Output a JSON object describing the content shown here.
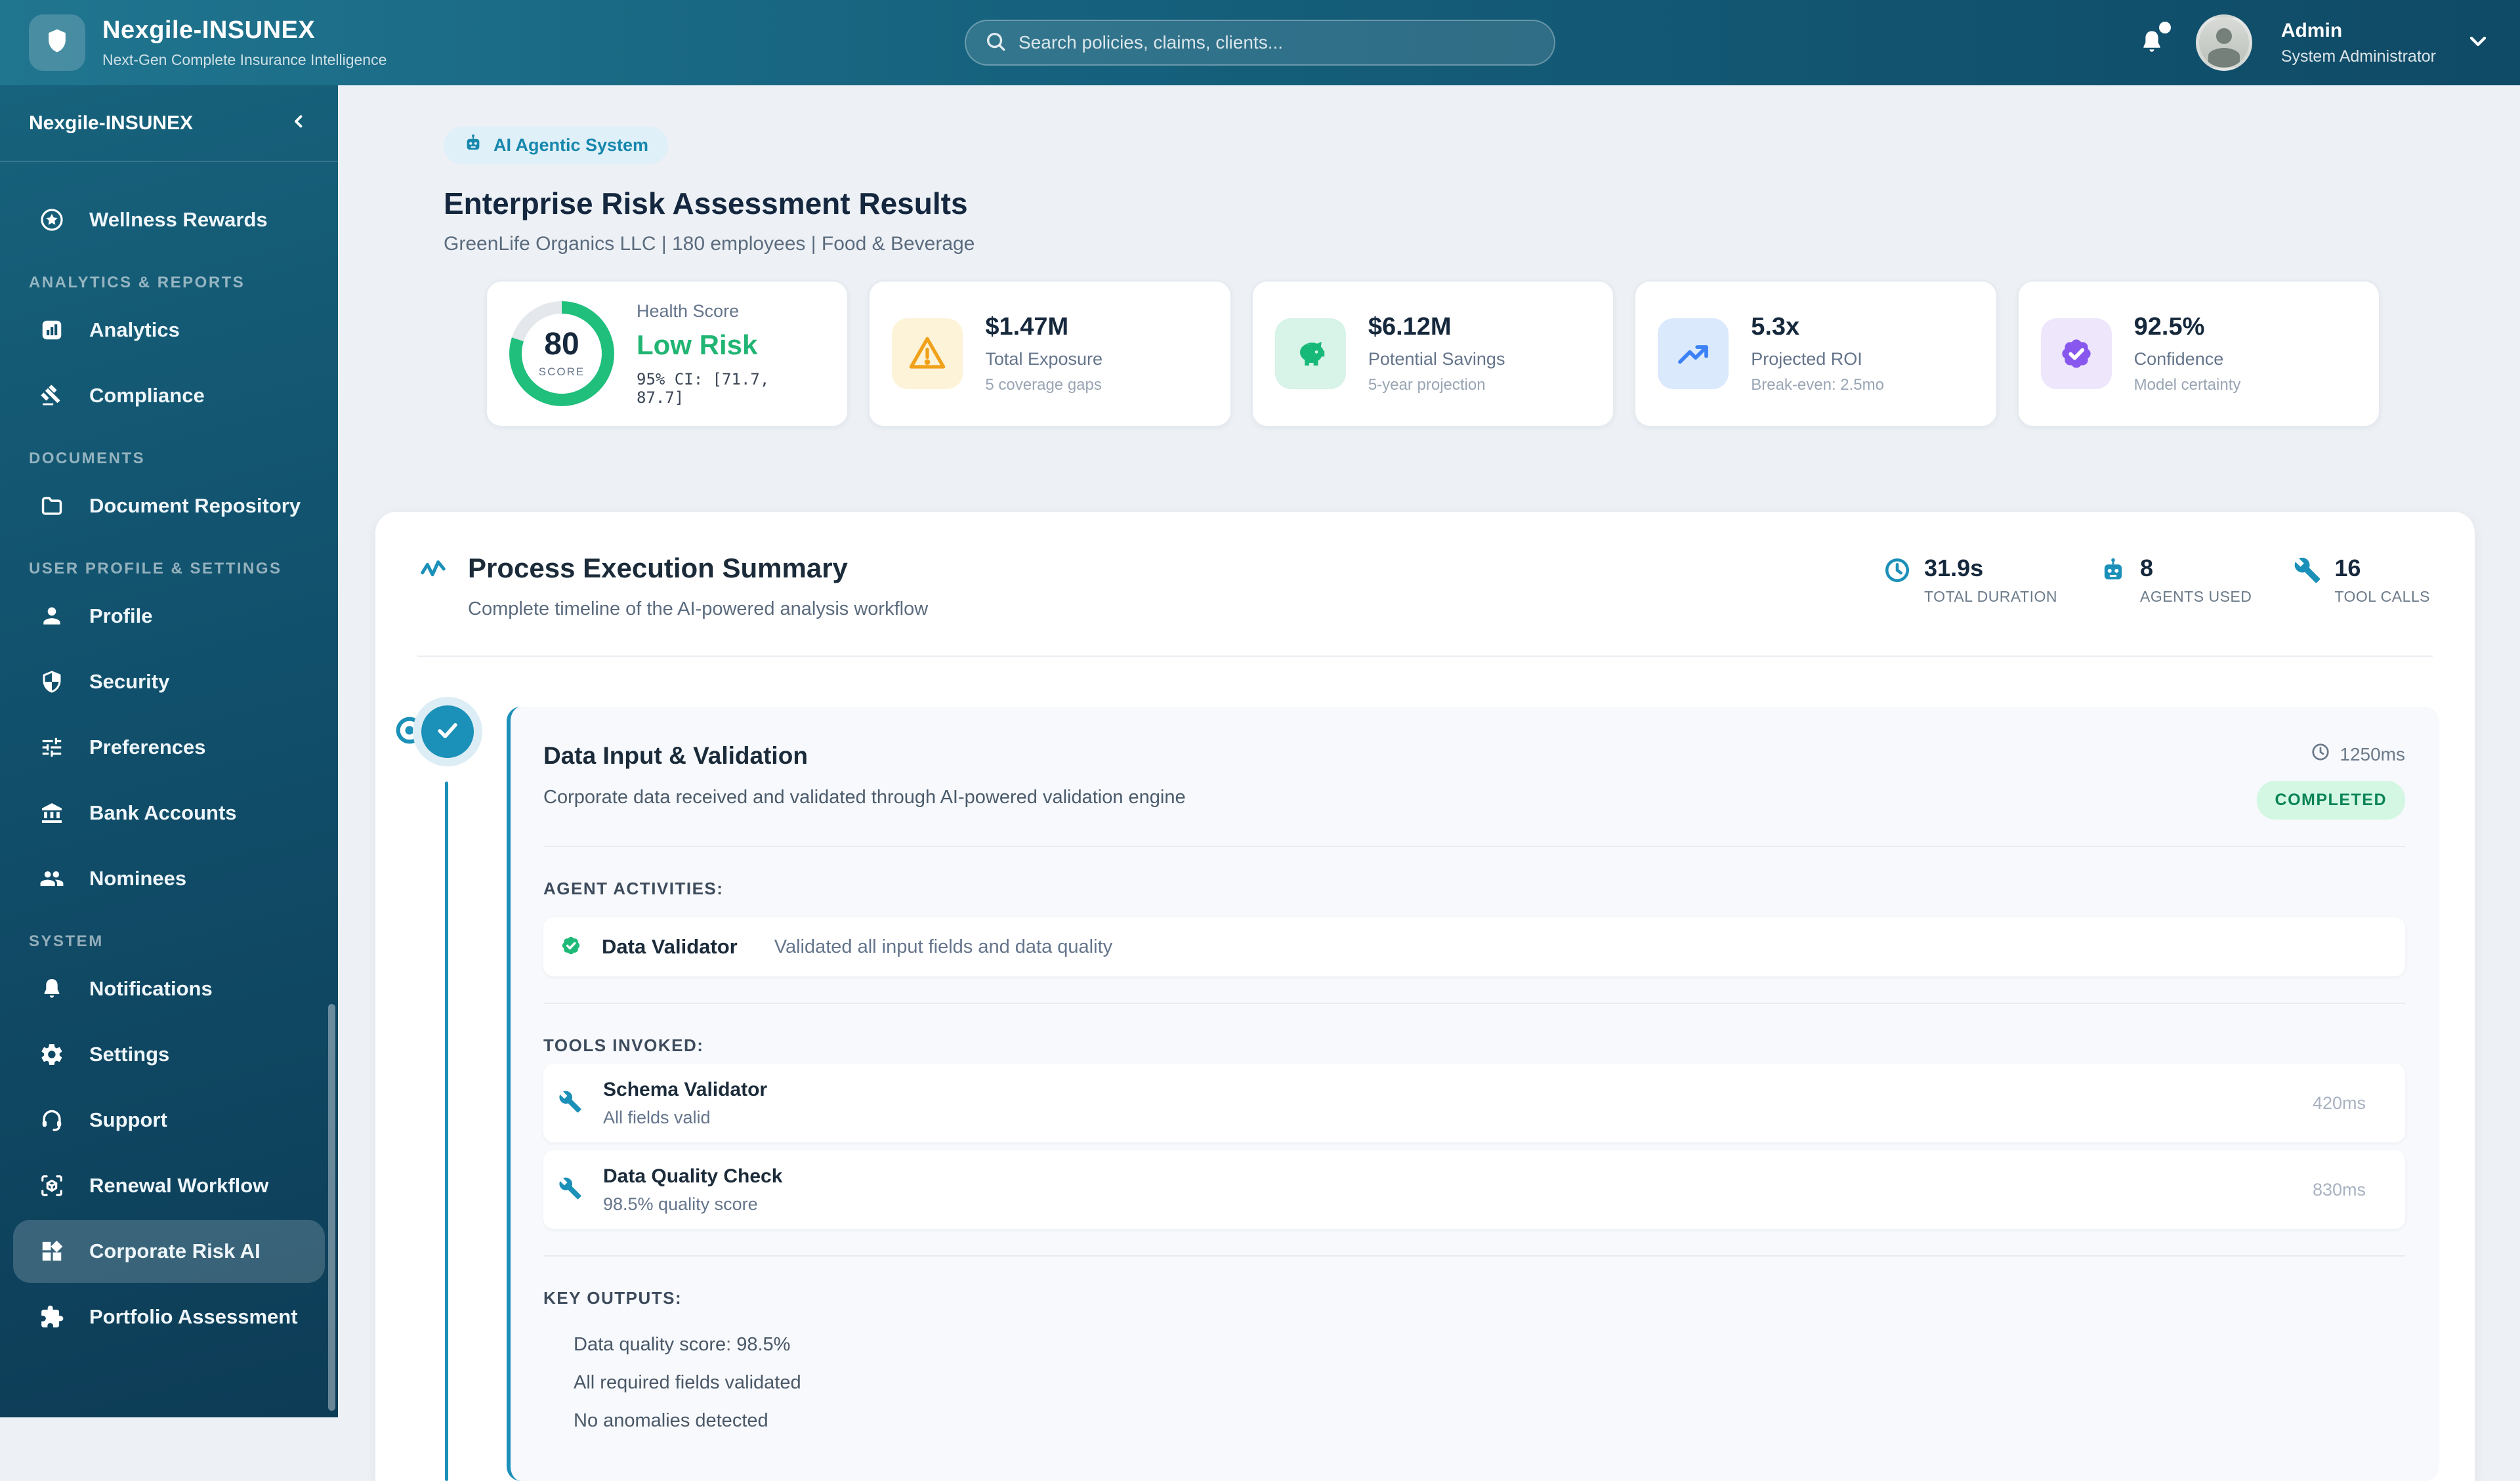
{
  "header": {
    "app_name": "Nexgile-INSUNEX",
    "tagline": "Next-Gen Complete Insurance Intelligence",
    "search_placeholder": "Search policies, claims, clients...",
    "user_name": "Admin",
    "user_role": "System Administrator"
  },
  "sidebar": {
    "brand": "Nexgile-INSUNEX",
    "entries": [
      {
        "type": "item",
        "label": "Wellness Rewards",
        "icon": "star-circle-icon",
        "active": false
      },
      {
        "type": "label",
        "label": "ANALYTICS & REPORTS"
      },
      {
        "type": "item",
        "label": "Analytics",
        "icon": "bar-chart-icon",
        "active": false
      },
      {
        "type": "item",
        "label": "Compliance",
        "icon": "gavel-icon",
        "active": false
      },
      {
        "type": "label",
        "label": "DOCUMENTS"
      },
      {
        "type": "item",
        "label": "Document Repository",
        "icon": "folder-icon",
        "active": false
      },
      {
        "type": "label",
        "label": "USER PROFILE & SETTINGS"
      },
      {
        "type": "item",
        "label": "Profile",
        "icon": "person-icon",
        "active": false
      },
      {
        "type": "item",
        "label": "Security",
        "icon": "shield-half-icon",
        "active": false
      },
      {
        "type": "item",
        "label": "Preferences",
        "icon": "sliders-icon",
        "active": false
      },
      {
        "type": "item",
        "label": "Bank Accounts",
        "icon": "bank-icon",
        "active": false
      },
      {
        "type": "item",
        "label": "Nominees",
        "icon": "people-icon",
        "active": false
      },
      {
        "type": "label",
        "label": "SYSTEM"
      },
      {
        "type": "item",
        "label": "Notifications",
        "icon": "bell-icon",
        "active": false
      },
      {
        "type": "item",
        "label": "Settings",
        "icon": "gear-icon",
        "active": false
      },
      {
        "type": "item",
        "label": "Support",
        "icon": "headset-icon",
        "active": false
      },
      {
        "type": "item",
        "label": "Renewal Workflow",
        "icon": "cube-scan-icon",
        "active": false
      },
      {
        "type": "item",
        "label": "Corporate Risk AI",
        "icon": "widgets-icon",
        "active": true
      },
      {
        "type": "item",
        "label": "Portfolio Assessment",
        "icon": "puzzle-icon",
        "active": false
      }
    ]
  },
  "page": {
    "badge_label": "AI Agentic System",
    "badge_icon": "robot-icon",
    "title": "Enterprise Risk Assessment Results",
    "subtitle": "GreenLife Organics LLC | 180 employees | Food & Beverage"
  },
  "stats": [
    {
      "icon": "health-ring",
      "score": "80",
      "score_label": "SCORE",
      "label": "Health Score",
      "value": "Low Risk",
      "sub": "95% CI: [71.7, 87.7]",
      "ring_percent": 80,
      "ring_color": "#20bf7c",
      "value_color": "#21b573"
    },
    {
      "icon": "warning-icon",
      "value": "$1.47M",
      "label": "Total Exposure",
      "sub": "5 coverage gaps",
      "icon_color": "#f0a11a",
      "icon_bg": "#fdf3d8"
    },
    {
      "icon": "piggy-bank-icon",
      "value": "$6.12M",
      "label": "Potential Savings",
      "sub": "5-year projection",
      "icon_color": "#17b978",
      "icon_bg": "#d8f3e7"
    },
    {
      "icon": "trending-up-icon",
      "value": "5.3x",
      "label": "Projected ROI",
      "sub": "Break-even: 2.5mo",
      "icon_color": "#3c82f6",
      "icon_bg": "#dbe9fd"
    },
    {
      "icon": "verified-icon",
      "value": "92.5%",
      "label": "Confidence",
      "sub": "Model certainty",
      "icon_color": "#8757ee",
      "icon_bg": "#eee7fc"
    }
  ],
  "summary": {
    "icon": "activity-icon",
    "title": "Process Execution Summary",
    "subtitle": "Complete timeline of the AI-powered analysis workflow",
    "metrics": [
      {
        "icon": "clock-icon",
        "value": "31.9s",
        "label": "TOTAL DURATION"
      },
      {
        "icon": "robot-icon",
        "value": "8",
        "label": "AGENTS USED"
      },
      {
        "icon": "wrench-icon",
        "value": "16",
        "label": "TOOL CALLS"
      }
    ]
  },
  "step": {
    "title": "Data Input & Validation",
    "duration": "1250ms",
    "status": "COMPLETED",
    "description": "Corporate data received and validated through AI-powered validation engine",
    "agents_section": "AGENT ACTIVITIES:",
    "agents": [
      {
        "icon": "seal-check-icon",
        "name": "Data Validator",
        "description": "Validated all input fields and data quality"
      }
    ],
    "tools_section": "TOOLS INVOKED:",
    "tools": [
      {
        "icon": "wrench-icon",
        "name": "Schema Validator",
        "result": "All fields valid",
        "duration": "420ms"
      },
      {
        "icon": "wrench-icon",
        "name": "Data Quality Check",
        "result": "98.5% quality score",
        "duration": "830ms"
      }
    ],
    "outputs_section": "KEY OUTPUTS:",
    "outputs": [
      "Data quality score: 98.5%",
      "All required fields validated",
      "No anomalies detected"
    ]
  },
  "colors": {
    "accent_teal": "#1b90b8",
    "header_gradient": [
      "#20758f",
      "#0f4a66"
    ],
    "sidebar_gradient": [
      "#17627c",
      "#0d3c56"
    ],
    "risk_green": "#21b573",
    "ring_green": "#20bf7c",
    "ring_track": "#e4e8ec",
    "completed_bg": "#d4f7e4",
    "completed_text": "#0a8456",
    "main_bg": "#edf1f5",
    "stepcard_bg": "#f7f9fc"
  }
}
